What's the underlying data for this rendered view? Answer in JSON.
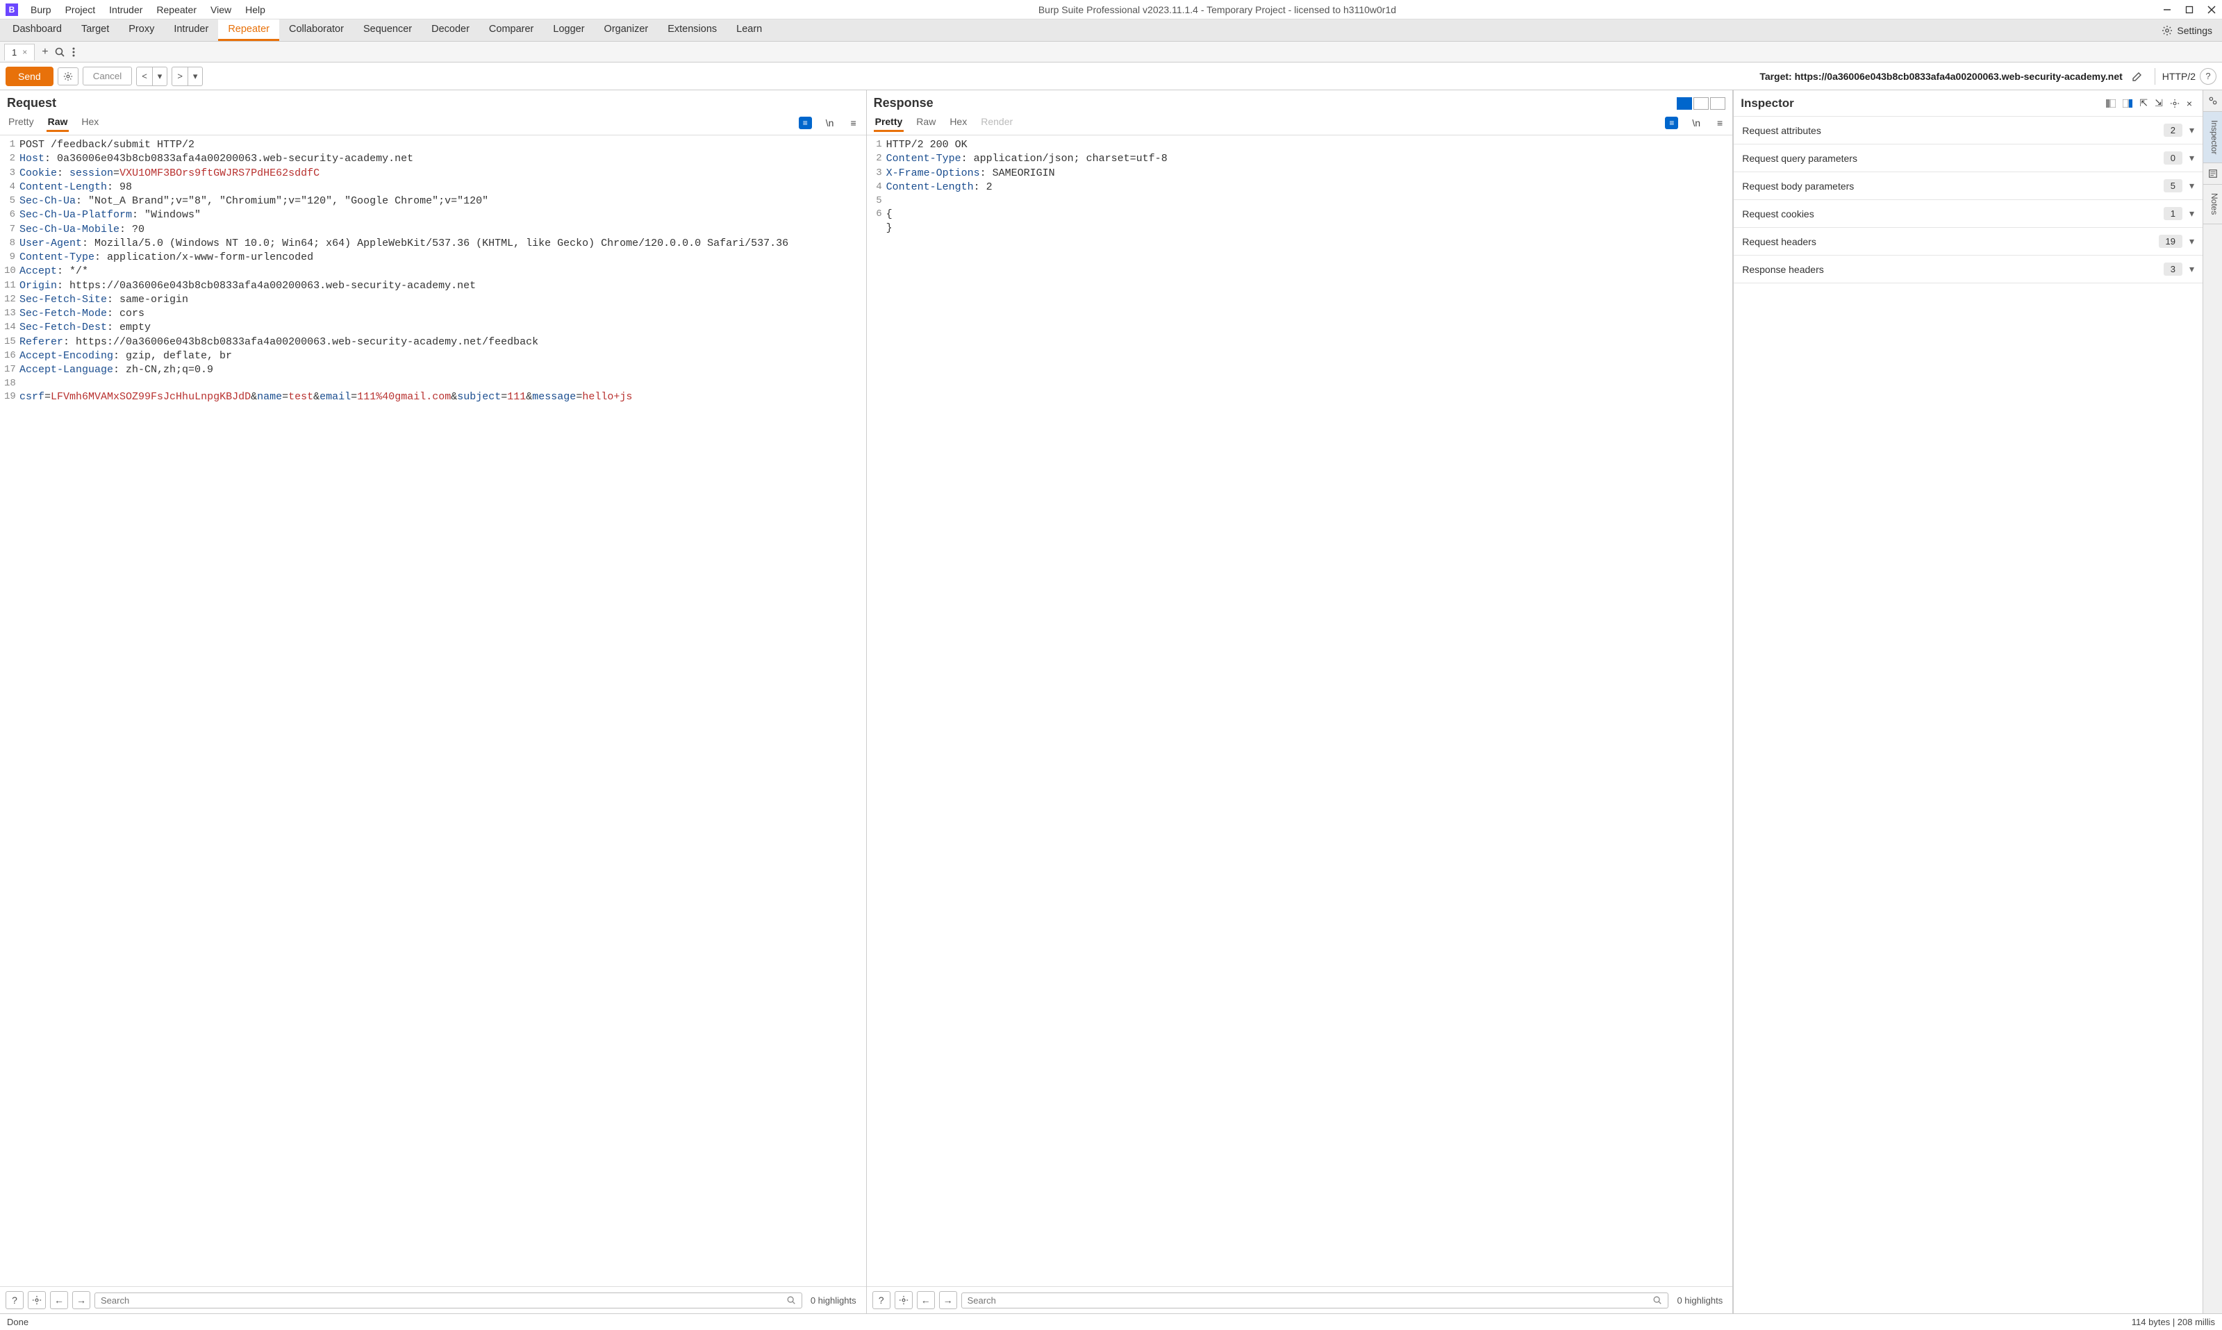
{
  "window": {
    "title": "Burp Suite Professional v2023.11.1.4 - Temporary Project - licensed to h3110w0r1d"
  },
  "menubar": [
    "Burp",
    "Project",
    "Intruder",
    "Repeater",
    "View",
    "Help"
  ],
  "main_tabs": [
    "Dashboard",
    "Target",
    "Proxy",
    "Intruder",
    "Repeater",
    "Collaborator",
    "Sequencer",
    "Decoder",
    "Comparer",
    "Logger",
    "Organizer",
    "Extensions",
    "Learn"
  ],
  "main_tab_active": "Repeater",
  "settings_label": "Settings",
  "repeater_tab": {
    "label": "1"
  },
  "action": {
    "send": "Send",
    "cancel": "Cancel",
    "target_prefix": "Target: ",
    "target_url": "https://0a36006e043b8cb0833afa4a00200063.web-security-academy.net",
    "protocol": "HTTP/2"
  },
  "request": {
    "title": "Request",
    "view_tabs": [
      "Pretty",
      "Raw",
      "Hex"
    ],
    "active_view": "Raw",
    "lines": [
      {
        "n": 1,
        "parts": [
          {
            "t": "POST /feedback/submit HTTP/2",
            "c": ""
          }
        ]
      },
      {
        "n": 2,
        "parts": [
          {
            "t": "Host",
            "c": "hdr-name"
          },
          {
            "t": ": ",
            "c": ""
          },
          {
            "t": "0a36006e043b8cb0833afa4a00200063.web-security-academy.net",
            "c": ""
          }
        ]
      },
      {
        "n": 3,
        "parts": [
          {
            "t": "Cookie",
            "c": "hdr-name"
          },
          {
            "t": ": ",
            "c": ""
          },
          {
            "t": "session",
            "c": "cookie-key"
          },
          {
            "t": "=",
            "c": ""
          },
          {
            "t": "VXU1OMF3BOrs9ftGWJRS7PdHE62sddfC",
            "c": "cookie-val"
          }
        ]
      },
      {
        "n": 4,
        "parts": [
          {
            "t": "Content-Length",
            "c": "hdr-name"
          },
          {
            "t": ": 98",
            "c": ""
          }
        ]
      },
      {
        "n": 5,
        "parts": [
          {
            "t": "Sec-Ch-Ua",
            "c": "hdr-name"
          },
          {
            "t": ": \"Not_A Brand\";v=\"8\", \"Chromium\";v=\"120\", \"Google Chrome\";v=\"120\"",
            "c": ""
          }
        ]
      },
      {
        "n": 6,
        "parts": [
          {
            "t": "Sec-Ch-Ua-Platform",
            "c": "hdr-name"
          },
          {
            "t": ": \"Windows\"",
            "c": ""
          }
        ]
      },
      {
        "n": 7,
        "parts": [
          {
            "t": "Sec-Ch-Ua-Mobile",
            "c": "hdr-name"
          },
          {
            "t": ": ?0",
            "c": ""
          }
        ]
      },
      {
        "n": 8,
        "parts": [
          {
            "t": "User-Agent",
            "c": "hdr-name"
          },
          {
            "t": ": Mozilla/5.0 (Windows NT 10.0; Win64; x64) AppleWebKit/537.36 (KHTML, like Gecko) Chrome/120.0.0.0 Safari/537.36",
            "c": ""
          }
        ]
      },
      {
        "n": 9,
        "parts": [
          {
            "t": "Content-Type",
            "c": "hdr-name"
          },
          {
            "t": ": application/x-www-form-urlencoded",
            "c": ""
          }
        ]
      },
      {
        "n": 10,
        "parts": [
          {
            "t": "Accept",
            "c": "hdr-name"
          },
          {
            "t": ": */*",
            "c": ""
          }
        ]
      },
      {
        "n": 11,
        "parts": [
          {
            "t": "Origin",
            "c": "hdr-name"
          },
          {
            "t": ": https://0a36006e043b8cb0833afa4a00200063.web-security-academy.net",
            "c": ""
          }
        ]
      },
      {
        "n": 12,
        "parts": [
          {
            "t": "Sec-Fetch-Site",
            "c": "hdr-name"
          },
          {
            "t": ": same-origin",
            "c": ""
          }
        ]
      },
      {
        "n": 13,
        "parts": [
          {
            "t": "Sec-Fetch-Mode",
            "c": "hdr-name"
          },
          {
            "t": ": cors",
            "c": ""
          }
        ]
      },
      {
        "n": 14,
        "parts": [
          {
            "t": "Sec-Fetch-Dest",
            "c": "hdr-name"
          },
          {
            "t": ": empty",
            "c": ""
          }
        ]
      },
      {
        "n": 15,
        "parts": [
          {
            "t": "Referer",
            "c": "hdr-name"
          },
          {
            "t": ": https://0a36006e043b8cb0833afa4a00200063.web-security-academy.net/feedback",
            "c": ""
          }
        ]
      },
      {
        "n": 16,
        "parts": [
          {
            "t": "Accept-Encoding",
            "c": "hdr-name"
          },
          {
            "t": ": gzip, deflate, br",
            "c": ""
          }
        ]
      },
      {
        "n": 17,
        "parts": [
          {
            "t": "Accept-Language",
            "c": "hdr-name"
          },
          {
            "t": ": zh-CN,zh;q=0.9",
            "c": ""
          }
        ]
      },
      {
        "n": 18,
        "parts": [
          {
            "t": "",
            "c": ""
          }
        ]
      },
      {
        "n": 19,
        "parts": [
          {
            "t": "csrf",
            "c": "body-key"
          },
          {
            "t": "=",
            "c": ""
          },
          {
            "t": "LFVmh6MVAMxSOZ99FsJcHhuLnpgKBJdD",
            "c": "body-val"
          },
          {
            "t": "&",
            "c": "amp"
          },
          {
            "t": "name",
            "c": "body-key"
          },
          {
            "t": "=",
            "c": ""
          },
          {
            "t": "test",
            "c": "body-val"
          },
          {
            "t": "&",
            "c": "amp"
          },
          {
            "t": "email",
            "c": "body-key"
          },
          {
            "t": "=",
            "c": ""
          },
          {
            "t": "111%40gmail.com",
            "c": "body-val"
          },
          {
            "t": "&",
            "c": "amp"
          },
          {
            "t": "subject",
            "c": "body-key"
          },
          {
            "t": "=",
            "c": ""
          },
          {
            "t": "111",
            "c": "body-val"
          },
          {
            "t": "&",
            "c": "amp"
          },
          {
            "t": "message",
            "c": "body-key"
          },
          {
            "t": "=",
            "c": ""
          },
          {
            "t": "hello+js",
            "c": "body-val"
          }
        ]
      }
    ],
    "search_placeholder": "Search",
    "highlights": "0 highlights"
  },
  "response": {
    "title": "Response",
    "view_tabs": [
      "Pretty",
      "Raw",
      "Hex",
      "Render"
    ],
    "active_view": "Pretty",
    "lines": [
      {
        "n": 1,
        "parts": [
          {
            "t": "HTTP/2 200 OK",
            "c": ""
          }
        ]
      },
      {
        "n": 2,
        "parts": [
          {
            "t": "Content-Type",
            "c": "hdr-name"
          },
          {
            "t": ": application/json; charset=utf-8",
            "c": ""
          }
        ]
      },
      {
        "n": 3,
        "parts": [
          {
            "t": "X-Frame-Options",
            "c": "hdr-name"
          },
          {
            "t": ": SAMEORIGIN",
            "c": ""
          }
        ]
      },
      {
        "n": 4,
        "parts": [
          {
            "t": "Content-Length",
            "c": "hdr-name"
          },
          {
            "t": ": 2",
            "c": ""
          }
        ]
      },
      {
        "n": 5,
        "parts": [
          {
            "t": "",
            "c": ""
          }
        ]
      },
      {
        "n": 6,
        "parts": [
          {
            "t": "{",
            "c": ""
          }
        ]
      },
      {
        "n": "",
        "parts": [
          {
            "t": "}",
            "c": ""
          }
        ]
      }
    ],
    "search_placeholder": "Search",
    "highlights": "0 highlights"
  },
  "inspector": {
    "title": "Inspector",
    "sections": [
      {
        "label": "Request attributes",
        "count": 2
      },
      {
        "label": "Request query parameters",
        "count": 0
      },
      {
        "label": "Request body parameters",
        "count": 5
      },
      {
        "label": "Request cookies",
        "count": 1
      },
      {
        "label": "Request headers",
        "count": 19
      },
      {
        "label": "Response headers",
        "count": 3
      }
    ]
  },
  "side_tabs": [
    "Inspector",
    "Notes"
  ],
  "status": {
    "left": "Done",
    "right": "114 bytes | 208 millis"
  }
}
